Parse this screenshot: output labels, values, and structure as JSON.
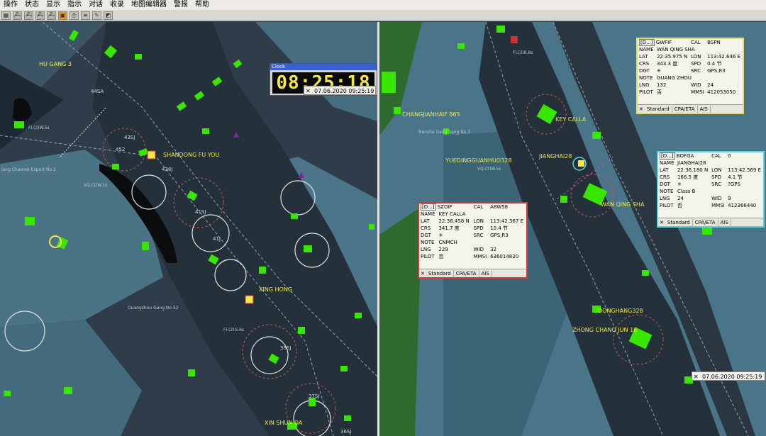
{
  "menu": [
    "操作",
    "状态",
    "显示",
    "指示",
    "对话",
    "收录",
    "地图编辑器",
    "警报",
    "帮助"
  ],
  "clock": {
    "title": "Clock",
    "time": "08:25:18"
  },
  "left_date": "07.06.2020 09:25:19",
  "right_date": "07.06.2020 09:25:19",
  "panels": [
    {
      "id": "GWFIF",
      "cal": "BSPN",
      "name": "WAN QING SHA",
      "lat": "22:35.975 N",
      "lon": "113:42.646 E",
      "crs": "343.3",
      "crs_unit": "度",
      "spd": "0.4",
      "spd_unit": "节",
      "dgt": "",
      "src": "GPS,R3",
      "note": "GUANG ZHOU",
      "lng": "132",
      "wid": "24",
      "pilot": "否",
      "mmsi": "412053050",
      "border": "#e3e06a"
    },
    {
      "id": "BOFQA",
      "cal": "0",
      "name": "JIANGHAI28",
      "lat": "22:36.180 N",
      "lon": "113:42.569 E",
      "crs": "166.5",
      "crs_unit": "度",
      "spd": "4.1",
      "spd_unit": "节",
      "dgt": "",
      "src": "?GPS",
      "note": "Class B",
      "lng": "24",
      "wid": "9",
      "pilot": "否",
      "mmsi": "412366440",
      "border": "#5ad4e0"
    },
    {
      "id": "SZOIF",
      "cal": "A8W58",
      "name": "KEY CALLA",
      "lat": "22:36.458 N",
      "lon": "113:42.367 E",
      "crs": "341.7",
      "crs_unit": "度",
      "spd": "10.4",
      "spd_unit": "节",
      "dgt": "",
      "src": "GPS,R3",
      "note": "CNMCH",
      "lng": "229",
      "wid": "32",
      "pilot": "否",
      "mmsi": "636014820",
      "border": "#d23a3a"
    }
  ],
  "labels": {
    "tabs": [
      "Standard",
      "CPA/ETA",
      "AIS"
    ],
    "name": "NAME",
    "lat": "LAT",
    "lon": "LON",
    "crs": "CRS",
    "spd": "SPD",
    "dgt": "DGT",
    "src": "SRC",
    "note": "NOTE",
    "lng": "LNG",
    "wid": "WID",
    "pilot": "PILOT",
    "mmsi": "MMSI",
    "cal": "CAL",
    "id_btn": "[D...]"
  },
  "map_left_text": {
    "hugang": "HU GANG 3",
    "shandong": "SHANDONG FU YOU",
    "xinghong": "XING HONG",
    "xinshun": "XIN SHUN DA",
    "a44sa": "44SA",
    "a43sj": "43SJ",
    "a41sj": "41SJ",
    "a39sj": "39SJ",
    "a37sj": "37SJ",
    "a36sj": "36SJ",
    "a452": "452",
    "a438j": "438J",
    "a41j": "41J",
    "channel": "iang Channel Export No 2",
    "guangzhou": "Guangzhou Gang No 52",
    "vq": "VQ.(1)W.1s",
    "fl": "Fl.(2)W.5s",
    "flg": "Fl.(2)G.6s"
  },
  "map_right_text": {
    "changjian": "CHANGJIANHAIF 865",
    "keycalla": "KEY CALLA",
    "jianghai": "JIANGHAI28",
    "wanqing": "WAN QING SHA",
    "yueding": "YUEDINGGUANHUO328",
    "donghang": "DONGHANG328",
    "zhongchang": "ZHONG CHANG JUN 16",
    "nansha": "Nansha Gang Sang No 3",
    "vqr": "VQ.(3)W.5s",
    "fl3": "Fl.(3)R.8s"
  }
}
